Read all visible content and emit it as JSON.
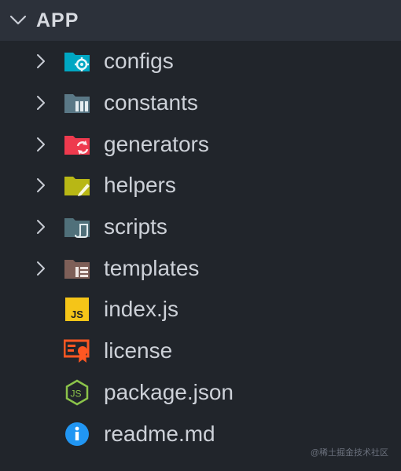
{
  "section": {
    "title": "APP",
    "expanded": true
  },
  "tree": {
    "folders": [
      {
        "label": "configs",
        "icon": "folder-config-icon",
        "color": "#00a7c3"
      },
      {
        "label": "constants",
        "icon": "folder-constant-icon",
        "color": "#5a7886"
      },
      {
        "label": "generators",
        "icon": "folder-generator-icon",
        "color": "#ee3a4e"
      },
      {
        "label": "helpers",
        "icon": "folder-helper-icon",
        "color": "#b8b715"
      },
      {
        "label": "scripts",
        "icon": "folder-scripts-icon",
        "color": "#50707a"
      },
      {
        "label": "templates",
        "icon": "folder-template-icon",
        "color": "#7e5f58"
      }
    ],
    "files": [
      {
        "label": "index.js",
        "icon": "javascript-icon",
        "color": "#f5c518"
      },
      {
        "label": "license",
        "icon": "license-icon",
        "color": "#ff5722"
      },
      {
        "label": "package.json",
        "icon": "nodejs-icon",
        "color": "#8bc34a"
      },
      {
        "label": "readme.md",
        "icon": "info-icon",
        "color": "#2196f3"
      }
    ]
  },
  "watermark": "@稀土掘金技术社区",
  "colors": {
    "background": "#21252b",
    "header_background": "#2c313a",
    "text": "#cdd1d8"
  }
}
